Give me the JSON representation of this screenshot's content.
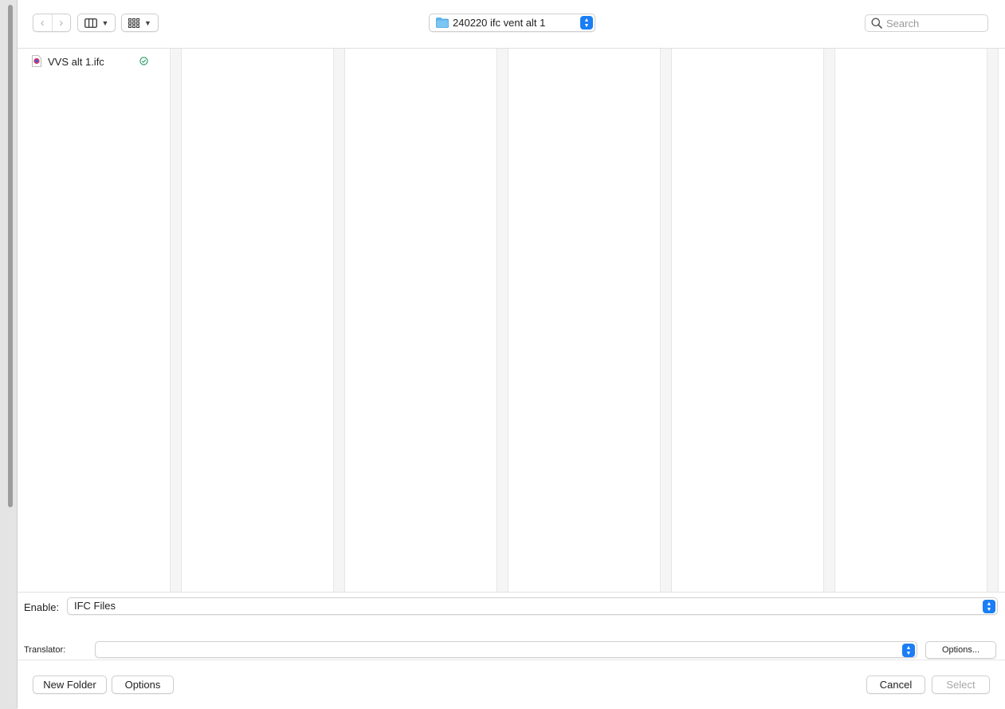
{
  "toolbar": {
    "back_icon": "chevron-left-icon",
    "forward_icon": "chevron-right-icon",
    "view_icon": "columns-view-icon",
    "group_icon": "grid-group-icon",
    "path_label": "240220 ifc vent alt 1",
    "search_placeholder": "Search",
    "search_value": ""
  },
  "files": [
    {
      "name": "VVS alt 1.ifc",
      "status": "synced-check-icon"
    }
  ],
  "enable": {
    "label": "Enable:",
    "value": "IFC Files"
  },
  "translator": {
    "label": "Translator:",
    "value": "",
    "options_label": "Options..."
  },
  "footer": {
    "new_folder_label": "New Folder",
    "options_label": "Options",
    "cancel_label": "Cancel",
    "select_label": "Select"
  },
  "colors": {
    "accent": "#1a7ef5",
    "folder": "#5fb6ee",
    "status_green": "#1f9a5c"
  }
}
